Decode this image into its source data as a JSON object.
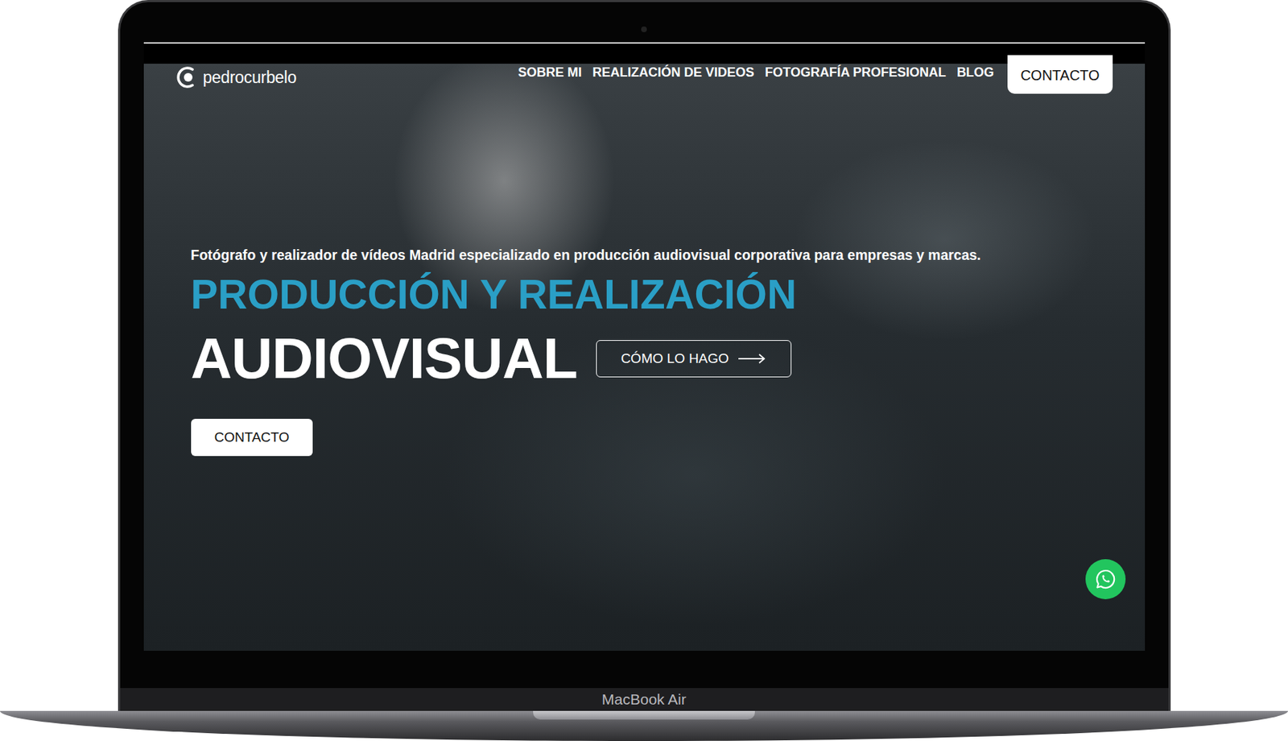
{
  "device": {
    "label": "MacBook Air"
  },
  "site": {
    "logo": "pedrocurbelo",
    "nav": [
      "SOBRE MI",
      "REALIZACIÓN DE VIDEOS",
      "FOTOGRAFÍA PROFESIONAL",
      "BLOG"
    ],
    "nav_button": "CONTACTO",
    "hero": {
      "subtitle": "Fotógrafo y realizador de vídeos Madrid especializado en producción audiovisual corporativa para empresas y marcas.",
      "headline_top": "PRODUCCIÓN Y REALIZACIÓN",
      "headline_bottom": "AUDIOVISUAL",
      "secondary_button": "CÓMO LO HAGO",
      "primary_button": "CONTACTO"
    }
  }
}
